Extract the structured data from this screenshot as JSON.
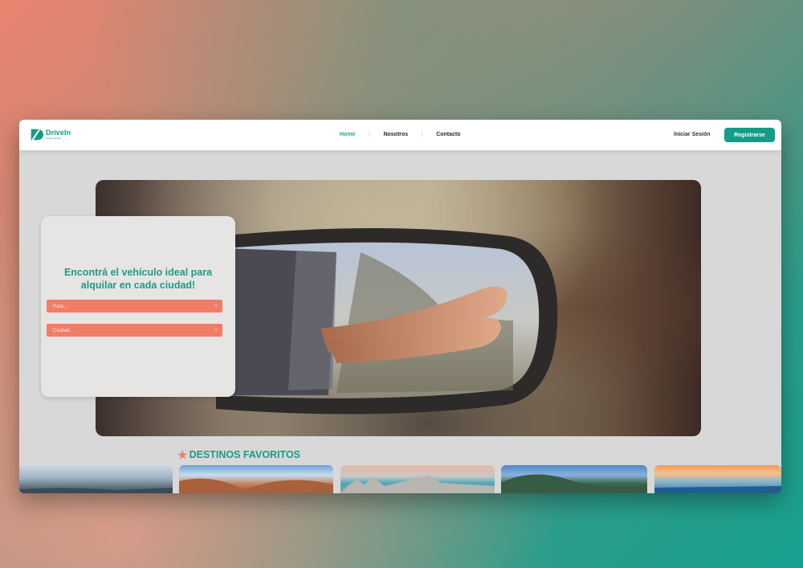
{
  "brand": {
    "name": "DriveIn",
    "tagline": "rental vehicles",
    "color": "#139c88"
  },
  "nav": {
    "items": [
      {
        "label": "Home",
        "active": true
      },
      {
        "label": "Nosotros",
        "active": false
      },
      {
        "label": "Contacto",
        "active": false
      }
    ],
    "separator": "⋮"
  },
  "auth": {
    "login_label": "Iniciar Sesión",
    "register_label": "Registrarse"
  },
  "search": {
    "title": "Encontrá el vehículo ideal para alquilar en cada ciudad!",
    "country_placeholder": "País...",
    "city_placeholder": "Ciudad...",
    "chevron": "⌄"
  },
  "destinations": {
    "title": "DESTINOS FAVORITOS",
    "star": "★",
    "cards": [
      "destination-1",
      "destination-2",
      "destination-3",
      "destination-4",
      "destination-5"
    ]
  },
  "colors": {
    "accent": "#139c88",
    "accent_text": "#1f9a87",
    "select_bg": "#f07d68",
    "page_bg": "#d8d8d8"
  }
}
